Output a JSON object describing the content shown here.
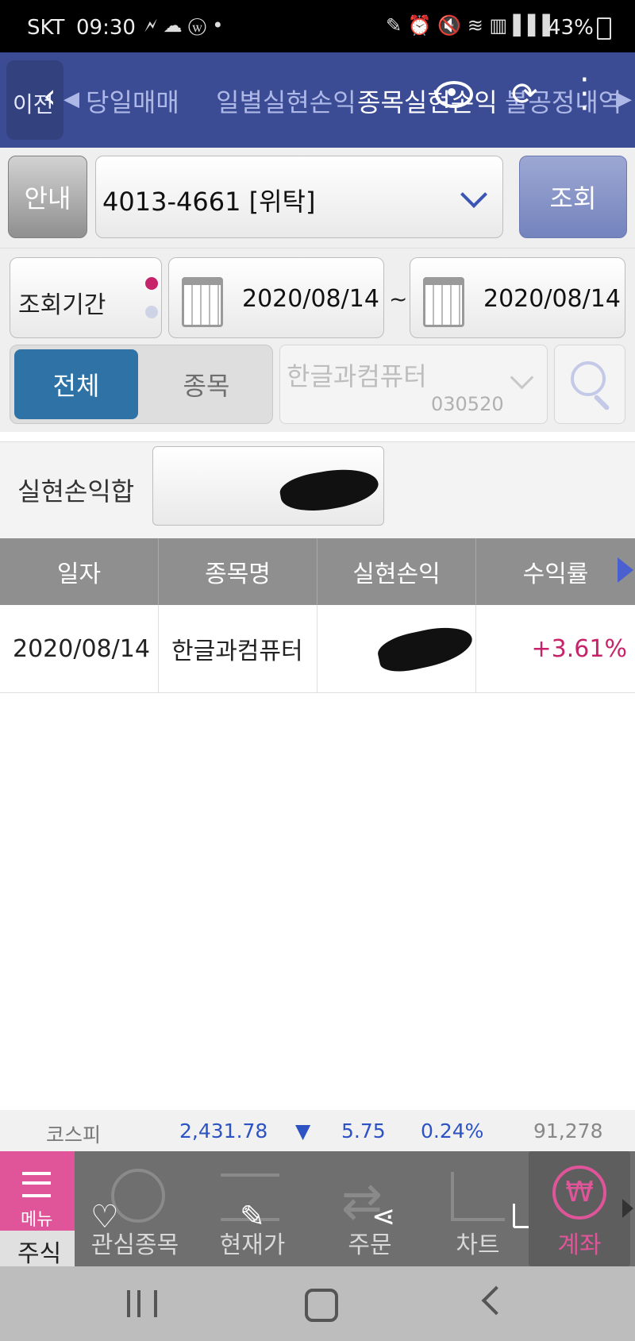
{
  "status_bar": {
    "carrier": "SKT",
    "time": "09:30",
    "battery": "43%"
  },
  "header": {
    "back_label": "이전",
    "tabs": [
      "당일매매",
      "일별실현손익",
      "종목실현손익",
      "불공정내역"
    ]
  },
  "account_bar": {
    "info_button": "안내",
    "account": "4013-4661 [위탁]",
    "query_button": "조회"
  },
  "period": {
    "label": "조회기간",
    "start_date": "2020/08/14",
    "separator": "~",
    "end_date": "2020/08/14"
  },
  "filter": {
    "all_label": "전체",
    "stock_label": "종목",
    "stock_name": "한글과컴퓨터",
    "stock_code": "030520"
  },
  "summary": {
    "label": "실현손익합"
  },
  "table": {
    "columns": [
      "일자",
      "종목명",
      "실현손익",
      "수익률"
    ],
    "rows": [
      {
        "date": "2020/08/14",
        "name": "한글과컴퓨터",
        "rate": "+3.61%"
      }
    ]
  },
  "ticker": {
    "index_name": "코스피",
    "value": "2,431.78",
    "direction": "▼",
    "change": "5.75",
    "change_pct": "0.24%",
    "volume": "91,278"
  },
  "bottom_nav": {
    "menu_label": "메뉴",
    "stock_label": "주식",
    "items": [
      "관심종목",
      "현재가",
      "주문",
      "차트",
      "계좌"
    ]
  },
  "colors": {
    "header_bg": "#3b4c95",
    "active_blue": "#2f73a6",
    "positive": "#c6236b",
    "ticker_blue": "#2c52c4",
    "menu_pink": "#e0559a"
  }
}
